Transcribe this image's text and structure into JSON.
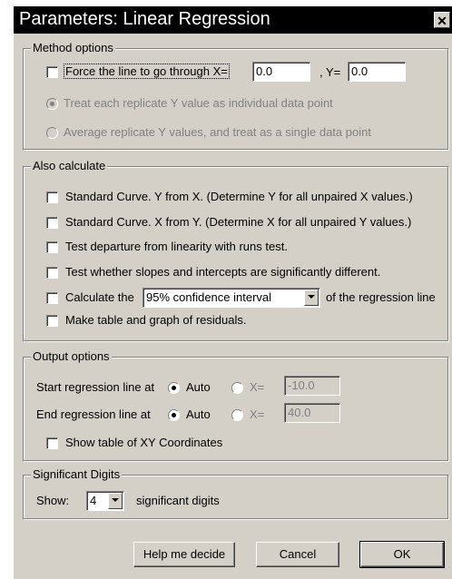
{
  "window": {
    "title": "Parameters: Linear Regression",
    "close_glyph": "✕"
  },
  "method_options": {
    "legend": "Method options",
    "force_label": "Force the line to go through X=",
    "force_checked": false,
    "x_value": "0.0",
    "y_label": ", Y=",
    "y_value": "0.0",
    "treat_each_label": "Treat each replicate Y value as individual data point",
    "treat_each_selected": true,
    "average_label": "Average replicate Y values, and treat as a single data point",
    "average_selected": false
  },
  "also_calculate": {
    "legend": "Also calculate",
    "std_y_from_x": "Standard Curve. Y from X. (Determine Y for all unpaired X values.)",
    "std_x_from_y": "Standard Curve. X from Y. (Determine X for all unpaired Y values.)",
    "runs_test": "Test departure from linearity with runs test.",
    "slopes_test": "Test whether slopes and intercepts are significantly different.",
    "calc_the": "Calculate the",
    "interval_value": "95% confidence interval",
    "of_regression": "of the regression line",
    "residuals": "Make table and graph of residuals."
  },
  "output_options": {
    "legend": "Output options",
    "start_label": "Start regression line at",
    "end_label": "End regression line at",
    "auto_label": "Auto",
    "x_eq_label": "X=",
    "start_x_value": "-10.0",
    "end_x_value": "40.0",
    "show_table_label": "Show table of XY Coordinates"
  },
  "significant_digits": {
    "legend": "Significant Digits",
    "show_label": "Show:",
    "digits_value": "4",
    "suffix": "significant digits"
  },
  "buttons": {
    "help": "Help me decide",
    "cancel": "Cancel",
    "ok": "OK"
  },
  "colors": {
    "face": "#d4d0c8",
    "titlebar": "#000000",
    "disabled_text": "#808080"
  }
}
